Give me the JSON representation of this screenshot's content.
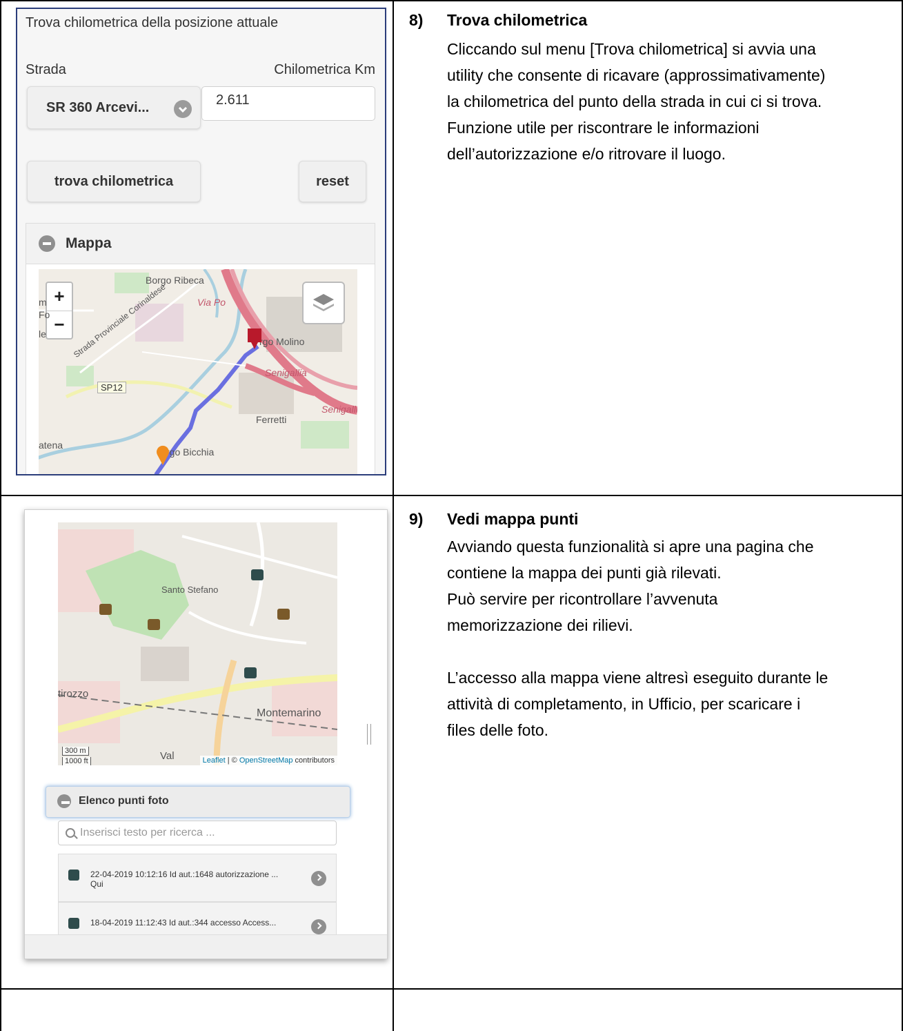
{
  "section8": {
    "number": "8)",
    "title": "Trova chilometrica",
    "lines": [
      "Cliccando sul menu [Trova chilometrica] si avvia una",
      "utility che consente di ricavare (approssimativamente)",
      "la chilometrica del punto della strada in cui ci si trova.",
      "Funzione utile per riscontrare le informazioni",
      "dell’autorizzazione e/o ritrovare il luogo."
    ],
    "screen": {
      "heading": "Trova chilometrica della posizione attuale",
      "strada_label": "Strada",
      "km_label": "Chilometrica Km",
      "road_value": "SR 360 Arcevi...",
      "km_value": "2.611",
      "trova_button": "trova chilometrica",
      "reset_button": "reset",
      "panel_title": "Mappa",
      "zoom_in": "+",
      "zoom_out": "−",
      "map_labels": {
        "borgo_ribeca": "Borgo Ribeca",
        "via_po": "Via Po",
        "strada_provinciale": "Strada Provinciale Corinaldese",
        "sp12": "SP12",
        "borgo_molino": "rgo Molino",
        "senigallia": "Senigallia",
        "senigalli": "Senigalli",
        "ferretti": "Ferretti",
        "borgo_bicchia": "rgo Bicchia",
        "atena": "atena",
        "m": "m",
        "fo": "Fo",
        "le": "le"
      }
    }
  },
  "section9": {
    "number": "9)",
    "title": "Vedi mappa punti",
    "lines": [
      "Avviando questa funzionalità si apre una pagina che",
      "contiene la mappa dei punti già rilevati.",
      "Può servire per ricontrollare l’avvenuta",
      "memorizzazione dei rilievi.",
      "",
      "L’accesso alla mappa viene altresì eseguito durante le",
      "attività di completamento, in Ufficio, per scaricare i",
      "files delle foto."
    ],
    "screen": {
      "map_labels": {
        "santo_stefano": "Santo Stefano",
        "montemarino": "Montemarino",
        "tirozzo": "tirozzo",
        "val": "Val"
      },
      "scale_m": "300 m",
      "scale_ft": "1000 ft",
      "attribution_leaflet": "Leaflet",
      "attribution_sep": " | © ",
      "attribution_osm": "OpenStreetMap",
      "attribution_tail": " contributors",
      "panel_title": "Elenco punti foto",
      "search_placeholder": "Inserisci testo per ricerca ...",
      "items": [
        {
          "line1": "22-04-2019 10:12:16 Id aut.:1648 autorizzazione ...",
          "line2": "Qui"
        },
        {
          "line1": "18-04-2019 11:12:43 Id aut.:344 accesso Access...",
          "line2": ""
        }
      ]
    }
  }
}
